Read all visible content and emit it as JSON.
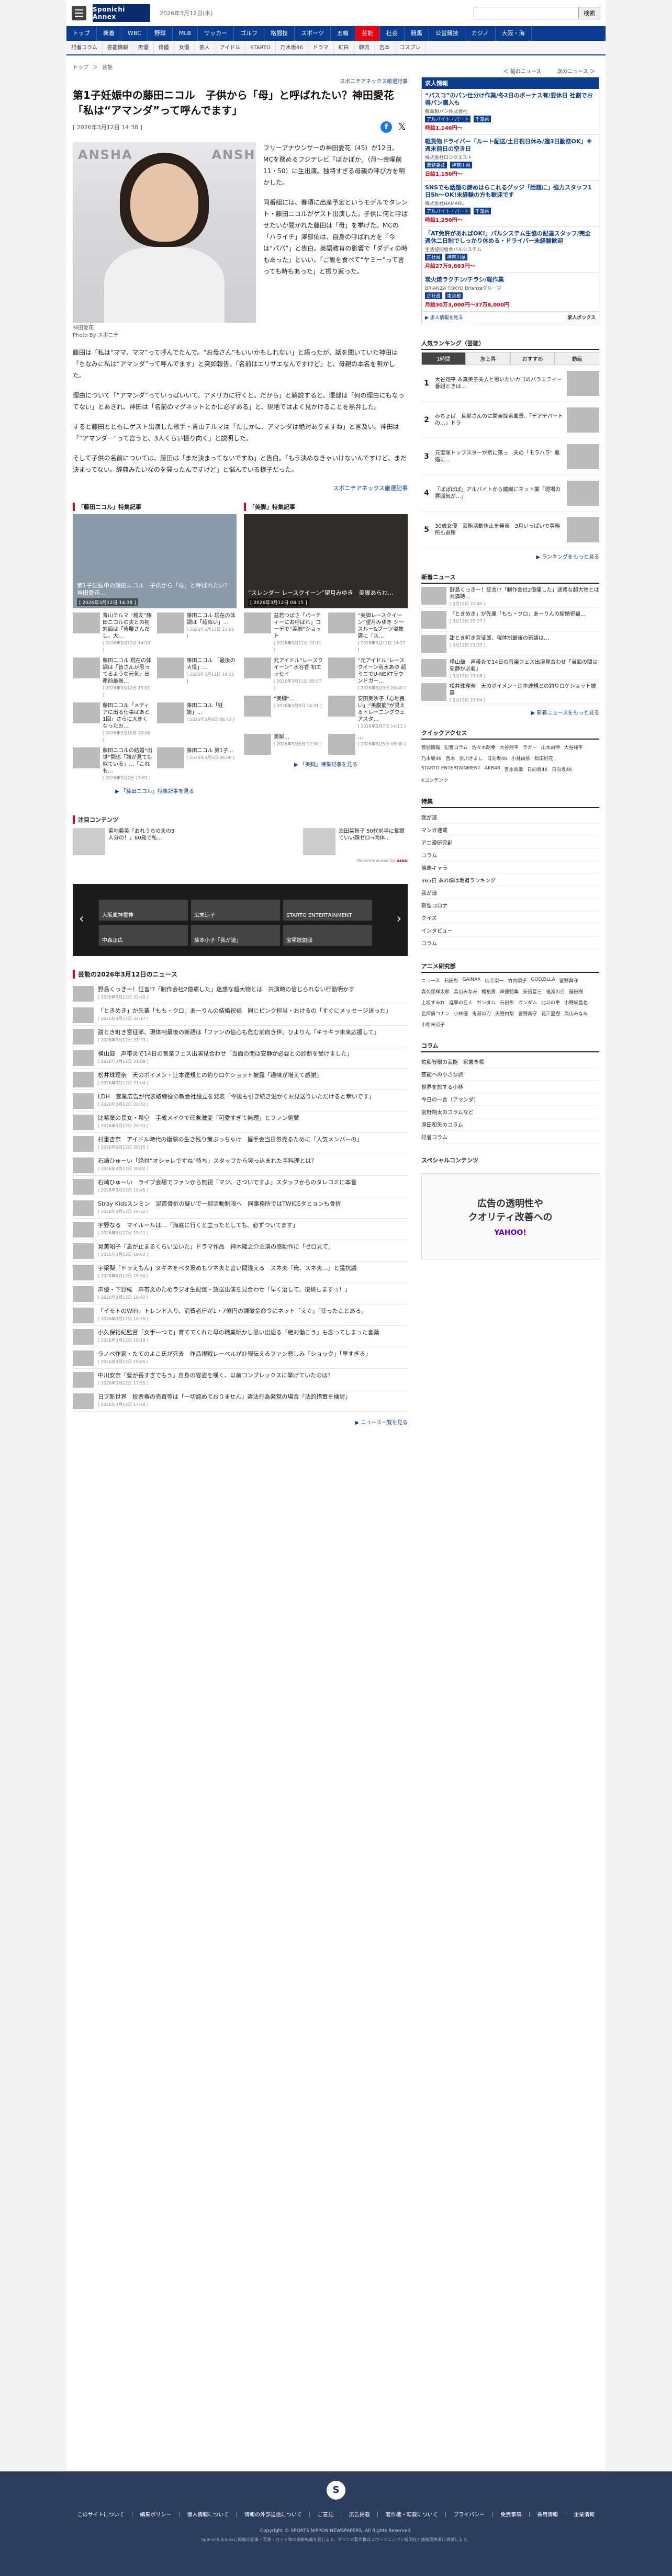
{
  "header": {
    "logo": "Sponichi Annex",
    "date": "2026年3月12日(木)",
    "search_button": "検索",
    "search_placeholder": ""
  },
  "gnav": [
    "トップ",
    "新着",
    "WBC",
    "野球",
    "MLB",
    "サッカー",
    "ゴルフ",
    "格闘技",
    "スポーツ",
    "五輪",
    "芸能",
    "社会",
    "競馬",
    "公営競技",
    "カジノ",
    "大阪・海"
  ],
  "gnav_active": "芸能",
  "snav": [
    "記者コラム",
    "芸能情報",
    "男優",
    "俳優",
    "女優",
    "芸人",
    "アイドル",
    "STARTO",
    "乃木坂46",
    "ドラマ",
    "紅白",
    "韓流",
    "吉本",
    "コスプレ"
  ],
  "breadcrumb": [
    "トップ",
    "＞",
    "芸能"
  ],
  "pager": {
    "prev": "＜ 前のニュース",
    "next": "次のニュース ＞"
  },
  "article": {
    "kicker": "スポニチアネックス厳選記事",
    "title": "第1子妊娠中の藤田ニコル　子供から「母」と呼ばれたい？神田愛花「私は“アマンダ”って呼んでます」",
    "timestamp": "[ 2026年3月12日 14:38 ]",
    "photo_caption": "神田愛花",
    "photo_credit": "Photo By スポニチ",
    "lead": "フリーアナウンサーの神田愛花（45）が12日、MCを務めるフジテレビ「ぽかぽか」（月〜金曜前11・50）に生出演。独特すぎる母親の呼び方を明かした。",
    "p1": "同番組には、春頃に出産予定というモデルでタレント・藤田ニコルがゲスト出演した。子供に何と呼ばせたいか聞かれた藤田は「母」を挙げた。MCの「ハライチ」澤部佑は、自身の呼ばれ方を「今は“パパ”」と告白。英語教育の影響で「ダディの時もあった」といい、「ご飯を食べて“ヤミー”って言っても時もあった」と振り返った。",
    "p2": "藤田は「私は“ママ、ママ”って呼んでたんで。“お母さん”もいいかもしれない」と語ったが、話を聞いていた神田は「ちなみに私は“アマンダ”って呼んでます」と突如報告。「名前はエリサエなんですけど」と、母親の本名を明かした。",
    "p3": "理由について「“アマンダ”っていっぱいいて、アメリカに行くと。だから」と解説すると、澤部は「何の理由にもなってない」とあきれ、神田は「名前のマグネットとかに必ずある」と、現地ではよく見かけることを熱弁した。",
    "p4": "すると藤田とともにゲスト出演した歌手・青山テルマは「たしかに、アマンダは絶対ありますね」と言及い。神田は「“アマンダー”って言うと、3人くらい振り向く」と説明した。",
    "p5": "そして子供の名前については、藤田は「まだ決まってないですね」と告白。「もう決めなきゃいけないんですけど、まだ決まってない。辞典みたいなのを買ったんですけど」と悩んでいる様子だった。",
    "source": "スポニチアネックス厳選記事"
  },
  "features": [
    {
      "heading": "「藤田ニコル」特集記事",
      "hero_title": "第1子妊娠中の藤田ニコル　子供から「母」と呼ばれたい？神田愛花…",
      "hero_date": "[ 2026年3月12日 14:38 ]",
      "items": [
        {
          "text": "青山テルマ “親友”藤田ニコルの夫との初対面は「修羅さんだし、大…",
          "date": "[ 2026年3月12日 14:19 ]"
        },
        {
          "text": "藤田ニコル 現在の体調は「超ぬい」…",
          "date": "[ 2026年3月12日 13:01 ]"
        },
        {
          "text": "藤田ニコル 現在の体調は「皆さんが思ってるような元気」出産前最後…",
          "date": "[ 2026年3月12日 13:01 ]"
        },
        {
          "text": "藤田ニコル 「最後の大役」…",
          "date": "[ 2026年3月11日 14:23 ]"
        },
        {
          "text": "藤田ニコル「メディアに出る仕事はあと1回」さらに大きくなったお…",
          "date": "[ 2026年3月10日 20:46 ]"
        },
        {
          "text": "藤田ニコル「妊娠」…",
          "date": "[ 2026年3月8日 08:43 ]"
        },
        {
          "text": "藤田ニコルの結婚“出世”関係「誰が見ても似ている」…「これも…",
          "date": "[ 2026年3月7日 17:03 ]"
        },
        {
          "text": "藤田ニコル 第1子…",
          "date": "[ 2026年3月5日 06:00 ]"
        }
      ],
      "more": "▶ 「藤田ニコル」特集記事を見る"
    },
    {
      "heading": "「美脚」特集記事",
      "hero_title": "“スレンダー レースクイーン”望月みゆき　美脚あらわ…",
      "hero_date": "[ 2026年3月12日 08:15 ]",
      "items": [
        {
          "text": "益若つばさ「パーティーにお呼ばれ」コーデで“美脚”ショット",
          "date": "[ 2026年3月12日 22:11 ]"
        },
        {
          "text": "“美脚レースクイーン”望月みゆき シースルー&ブーツ姿披露に「ス…",
          "date": "[ 2026年3月12日 14:27 ]"
        },
        {
          "text": "元アイドル“レースクイーン” 水谷香 初エッセイ",
          "date": "[ 2026年3月11日 09:57 ]"
        },
        {
          "text": "“元アイドル”レースクイーン雨水あゆ 超ミニでU-NEXTラウンドガー…",
          "date": "[ 2026年3月9日 20:40 ]"
        },
        {
          "text": "“美脚”…",
          "date": "[ 2026年3月8日 14:31 ]"
        },
        {
          "text": "安田美沙子「心地良い」“美腹筋”が見えるトレーニングウェアスタ…",
          "date": "[ 2026年3月7日 14:11 ]"
        },
        {
          "text": "美脚…",
          "date": "[ 2026年3月6日 12:30 ]"
        },
        {
          "text": "…",
          "date": "[ 2026年3月5日 08:00 ]"
        }
      ],
      "more": "▶ 「美脚」特集記事を見る"
    }
  ],
  "hot": {
    "heading": "注目コンテンツ",
    "cards": [
      {
        "text": "菊地亜美「おれうちの夫の3人分の！」60歳で私…"
      },
      {
        "text": ""
      },
      {
        "text": ""
      },
      {
        "text": "泊田栞智子 50代前半に奮闘ていい顔ゼロ→肉体…"
      }
    ],
    "recommended": "Recommended by"
  },
  "carousel": [
    {
      "label": "大阪風神雷神"
    },
    {
      "label": "広末涼子"
    },
    {
      "label": "STARTO ENTERTAINMENT"
    },
    {
      "label": "中森正広"
    },
    {
      "label": "藤本小子「我が道」"
    },
    {
      "label": "宝塚歌劇団"
    }
  ],
  "news_heading": "芸能の2026年3月12日のニュース",
  "news": [
    {
      "text": "野島くっきー！証言!?「制作会社2億痛した」迷惑な超大物とは　共演時の信じられない行動明かす",
      "date": "[ 2026年3月12日 22:45 ]"
    },
    {
      "text": "「ときめき」が先輩「もも・クロ」あーりんの結婚祝福　同じピンク担当・おけるの「すぐにメッセージ送った」",
      "date": "[ 2026年3月12日 22:17 ]"
    },
    {
      "text": "甜とき町き宮征郎、現体制最後の新語は「ファンの信心も危む前向き伴」ひよりん「キラキラ未来応援して」",
      "date": "[ 2026年3月12日 21:33 ]"
    },
    {
      "text": "横山鼓　声帯炎で14日の音楽フェス出演見合わせ「当面の間は安静が必要との診断を受けました」",
      "date": "[ 2026年3月12日 21:08 ]"
    },
    {
      "text": "松井珠理奈　天のボイメン・辻本達規との釣りロケショット披露「趣味が増えて感謝」",
      "date": "[ 2026年3月12日 21:04 ]"
    },
    {
      "text": "LDH　営業広告が代表取締役の新会社設立を発表「今後も引き続き温かくお見送りいただけると幸いです」",
      "date": "[ 2026年3月12日 20:42 ]"
    },
    {
      "text": "比希業の長女・希空　手成メイクで印象激変「可愛すぎて無理」とファン絶賛",
      "date": "[ 2026年3月12日 20:33 ]"
    },
    {
      "text": "村重杏奈　アイドル時代の衝撃の生き残り策ぶっちゃけ　握手会当日券売るために「人気メンバーの」",
      "date": "[ 2026年3月12日 20:15 ]"
    },
    {
      "text": "石崎ひゅーい「絶対“オシャレですね”待ち」スタッフから突っ込まれた手料理とは？",
      "date": "[ 2026年3月12日 20:02 ]"
    },
    {
      "text": "石崎ひゅーい　ライブ会場でファンから無視「マジ、さついですよ」スタッフからのタレコミに本音",
      "date": "[ 2026年3月12日 19:45 ]"
    },
    {
      "text": "Stray Kidsスンミン　足首骨折の疑いで一部活動制限へ　同事務所ではTWICEダヒョンも骨折",
      "date": "[ 2026年3月12日 19:32 ]"
    },
    {
      "text": "宇野なる　マイルールは…「海底に行くと立ったとしても、必ずついてます」",
      "date": "[ 2026年3月12日 19:21 ]"
    },
    {
      "text": "晃美昭子「息が止まるくらい泣いた」ドラマ作品　神木隆之介主演の感動作に「ゼロ見て」",
      "date": "[ 2026年3月12日 19:03 ]"
    },
    {
      "text": "宇梁梨「ドラえもん」ヌキネをペタ褒めもツネ夫と言い間違える　スネ夫「俺、スネ夫…」と猛抗議",
      "date": "[ 2026年3月12日 18:50 ]"
    },
    {
      "text": "声優・下野紘　声帯炎のためラジオ生配信・放送出演を見合わせ「早く治して、復帰しますっ！」",
      "date": "[ 2026年3月12日 18:42 ]"
    },
    {
      "text": "「イモトのWiFi」トレンド入り、消費者庁が1・7億円の課徴金命令にネット「えぐ」「使ったことある」",
      "date": "[ 2026年3月12日 18:30 ]"
    },
    {
      "text": "小久保裕紀監督「女手一つで」育ててくれた母の職業明かし思い出語る「絶対働こう」も念ってしまった言葉",
      "date": "[ 2026年3月12日 18:19 ]"
    },
    {
      "text": "ラノペ作家・たてのよこ氏が死去　作品視戦レーベルが訃報伝えるファン悲しみ「ショック」「早すぎる」",
      "date": "[ 2026年3月12日 18:05 ]"
    },
    {
      "text": "中川安奈「髪が長すぎでもう」自身の容姿を嘆く、以前コンプレックスに挙げていたのは？",
      "date": "[ 2026年3月12日 17:55 ]"
    },
    {
      "text": "日プ新世界　投票権の売買等は「一切認めておりません」違法行為発覚の場合「法的措置を検討」",
      "date": "[ 2026年3月12日 17:40 ]"
    }
  ],
  "news_more": "▶ ニュース一覧を見る",
  "jobs": {
    "heading": "求人情報",
    "items": [
      {
        "title": "“パスコ”のパン仕分け作業/冬2日のボーナス有/要休日 社割でお得パン購入も",
        "company": "敷島製パン株式会社",
        "tags": [
          "アルバイト・パート",
          "千葉県"
        ],
        "pay": "時給1,140円〜"
      },
      {
        "title": "軽貨物ドライバー「ルート配送/土日祝日休み/週3日勤務OK」※週末前日の空き日",
        "company": "株式会社ロジクエスト",
        "tags": [
          "業務委託",
          "神奈川県"
        ],
        "pay": "日給1,150円〜"
      },
      {
        "title": "SNSでも話題の諦めはらこれるグッジ「話題に」強力スタッフ1日5h〜OK!未経験の方も歓迎です",
        "company": "株式会社HAMARU",
        "tags": [
          "アルバイト・パート",
          "千葉県"
        ],
        "pay": "時給1,250円〜"
      },
      {
        "title": "「AT免許があればOK!」パルシステム生協の配達スタッフ/完全週休二日制でしっかり休める・ドライバー未経験歓迎",
        "company": "生活協同組合パルシステム",
        "tags": [
          "正社員",
          "神奈川県"
        ],
        "pay": "月給27万9,883円〜"
      },
      {
        "title": "炭火焼ラクチン/チラシ/軽作業",
        "company": "BRIANZA TOKYO Brianzaグループ",
        "tags": [
          "正社員",
          "東京都"
        ],
        "pay": "月給30万3,000円〜37万8,000円"
      }
    ],
    "more": "▶ 求人情報を見る",
    "brand": "求人ボックス"
  },
  "ranking": {
    "heading": "人気ランキング（芸能）",
    "tabs": [
      "1時間",
      "急上昇",
      "おすすめ",
      "動画"
    ],
    "items": [
      {
        "rank": "1",
        "text": "大谷翔平 ＆真美子夫人と思いたいカゴのバラエティー番組ときは…"
      },
      {
        "rank": "2",
        "text": "みちょぱ　旦那さんのに関東探索風景、「デアデパートの…」ドラ"
      },
      {
        "rank": "3",
        "text": "元宝塚トップスターが京に落っ　夫の「モラハラ” 離婚に…"
      },
      {
        "rank": "4",
        "text": "「ぱぱぱぱ」アルバイトから鍵織にネット業「現場の雰囲気が…」"
      },
      {
        "rank": "5",
        "text": "30歳女優　芸能活動休止を発表　3月いっぱいで事務所も退所"
      }
    ],
    "more": "▶ ランキングをもっと見る"
  },
  "side_news": {
    "heading": "新着ニュース",
    "items": [
      {
        "text": "野島くっきー！証言!?「制作会社2億痛した」迷惑な超大物とは　共演時…",
        "date": "[ 3月12日 22:45 ]"
      },
      {
        "text": "「ときめき」が先輩「もも・クロ」あーりんの結婚祝福…",
        "date": "[ 3月12日 22:17 ]"
      },
      {
        "text": "甜とき町き宮征郎、現体制最後の新語は…",
        "date": "[ 3月12日 21:33 ]"
      },
      {
        "text": "横山鼓　声帯炎で14日の音楽フェス出演見合わせ「当面の間は安静が必要」",
        "date": "[ 3月12日 21:08 ]"
      },
      {
        "text": "松井珠理奈　天のボイメン・辻本達規との釣りロケショット披露",
        "date": "[ 3月12日 21:04 ]"
      }
    ],
    "more": "▶ 新着ニュースをもっと見る"
  },
  "quick": {
    "heading": "クイックアクセス",
    "items": [
      "芸能情報",
      "記者コラム",
      "佐々木朗希",
      "大谷翔平",
      "ラガー",
      "山本由伸",
      "大谷翔平",
      "乃木坂46",
      "吉本",
      "氷川きよし",
      "日向坂46",
      "小林由依",
      "松田好花",
      "STARTO ENTERTAINMENT",
      "AKB48",
      "吉本興業",
      "日向坂46",
      "日向坂46",
      "Kコンテンツ"
    ]
  },
  "special": {
    "heading": "特集",
    "items": [
      "我が道",
      "マンガ連載",
      "アニ漫研究部",
      "コラム",
      "競馬キャラ",
      "365日 あの頃は坂道ランキング",
      "我が道",
      "新型コロナ",
      "クイズ",
      "インタビュー",
      "コラム"
    ]
  },
  "anime": {
    "heading": "アニメ研究部",
    "items": [
      "ニュース",
      "石田彰",
      "GAINAX",
      "山寺宏一",
      "竹内順子",
      "GODZILLA",
      "宮野真守",
      "森久保祥太郎",
      "高山みなみ",
      "梶裕貴",
      "声優特集",
      "安倍晋三",
      "鬼滅の刃",
      "藤田咲",
      "上坂すみれ",
      "進撃の巨人",
      "ガンダム",
      "石田彰",
      "ガンダム",
      "北斗の拳",
      "小野坂昌也",
      "名探偵コナン",
      "小林優",
      "鬼滅の刃",
      "天野由梨",
      "宮野真守",
      "花江夏樹",
      "高山みなみ",
      "小松未可子"
    ]
  },
  "column": {
    "heading": "コラム",
    "items": [
      "佐藤智樹の芸能　家書き帳",
      "芸能への小さな旅",
      "世界を旅する小林",
      "今日の一言（アマンダ）",
      "宮野翔太のコラムなど",
      "原田和矢のコラム",
      "記者コラム"
    ]
  },
  "sponsor_heading": "スペシャルコンテンツ",
  "ad": {
    "line1": "広告の透明性や",
    "line2": "クオリティ改善への",
    "brand": "YAHOO!"
  },
  "footer": {
    "logo": "S",
    "links": [
      "このサイトについて",
      "｜",
      "編集ポリシー",
      "｜",
      "個人情報について",
      "｜",
      "情報の外部送信について",
      "｜",
      "ご意見",
      "｜",
      "広告掲載",
      "｜",
      "著作権・転載について",
      "｜",
      "プライバシー",
      "｜",
      "免責事項",
      "｜",
      "採用情報",
      "｜",
      "企業情報"
    ],
    "copyright": "Copyright © SPORTS NIPPON NEWSPAPERS. All Rights Reserved.",
    "note": "Sponichi Annexに掲載の記事・写真・カット等の無断転載を禁じます。すべての著作権はスポーツニッポン新聞社と情報提供者に帰属します。"
  }
}
